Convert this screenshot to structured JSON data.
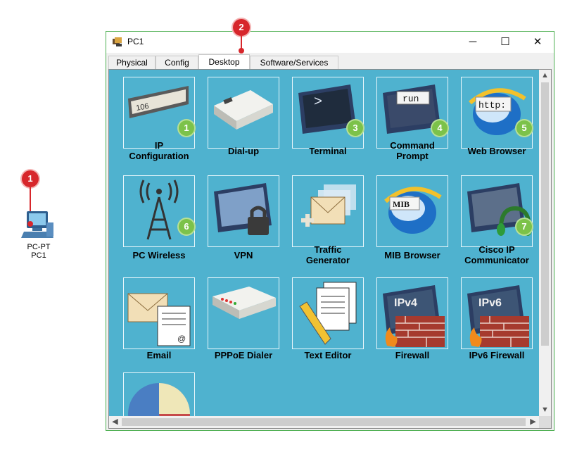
{
  "desktop": {
    "device": {
      "type_label": "PC-PT",
      "name_label": "PC1",
      "icon": "pc-icon"
    },
    "step_badges": [
      "1",
      "2"
    ]
  },
  "window": {
    "title": "PC1",
    "app_icon": "packet-tracer-icon",
    "controls": {
      "minimize": "─",
      "maximize": "☐",
      "close": "✕"
    },
    "tabs": [
      {
        "label": "Physical",
        "active": false
      },
      {
        "label": "Config",
        "active": false
      },
      {
        "label": "Desktop",
        "active": true
      },
      {
        "label": "Software/Services",
        "active": false
      }
    ]
  },
  "apps": [
    {
      "label": "IP\nConfiguration",
      "icon": "ip-config-icon",
      "badge": "1"
    },
    {
      "label": "Dial-up",
      "icon": "modem-icon",
      "badge": ""
    },
    {
      "label": "Terminal",
      "icon": "terminal-icon",
      "badge": "3"
    },
    {
      "label": "Command\nPrompt",
      "icon": "command-prompt-icon",
      "badge": "4",
      "icon_text": "run"
    },
    {
      "label": "Web Browser",
      "icon": "web-browser-icon",
      "badge": "5",
      "icon_text": "http:"
    },
    {
      "label": "PC Wireless",
      "icon": "wireless-icon",
      "badge": "6"
    },
    {
      "label": "VPN",
      "icon": "vpn-icon",
      "badge": ""
    },
    {
      "label": "Traffic\nGenerator",
      "icon": "traffic-generator-icon",
      "badge": ""
    },
    {
      "label": "MIB Browser",
      "icon": "mib-browser-icon",
      "badge": "",
      "icon_text": "MIB"
    },
    {
      "label": "Cisco IP\nCommunicator",
      "icon": "ip-communicator-icon",
      "badge": "7"
    },
    {
      "label": "Email",
      "icon": "email-icon",
      "badge": ""
    },
    {
      "label": "PPPoE Dialer",
      "icon": "pppoe-dialer-icon",
      "badge": ""
    },
    {
      "label": "Text Editor",
      "icon": "text-editor-icon",
      "badge": ""
    },
    {
      "label": "Firewall",
      "icon": "firewall-icon",
      "badge": "",
      "icon_text": "IPv4"
    },
    {
      "label": "IPv6 Firewall",
      "icon": "ipv6-firewall-icon",
      "badge": "",
      "icon_text": "IPv6"
    },
    {
      "label": "",
      "icon": "pie-chart-icon",
      "badge": ""
    }
  ],
  "colors": {
    "desktop_bg": "#4fb2cf",
    "badge_green": "#7cc24a",
    "badge_red": "#d7262b",
    "window_border": "#4caf50"
  }
}
